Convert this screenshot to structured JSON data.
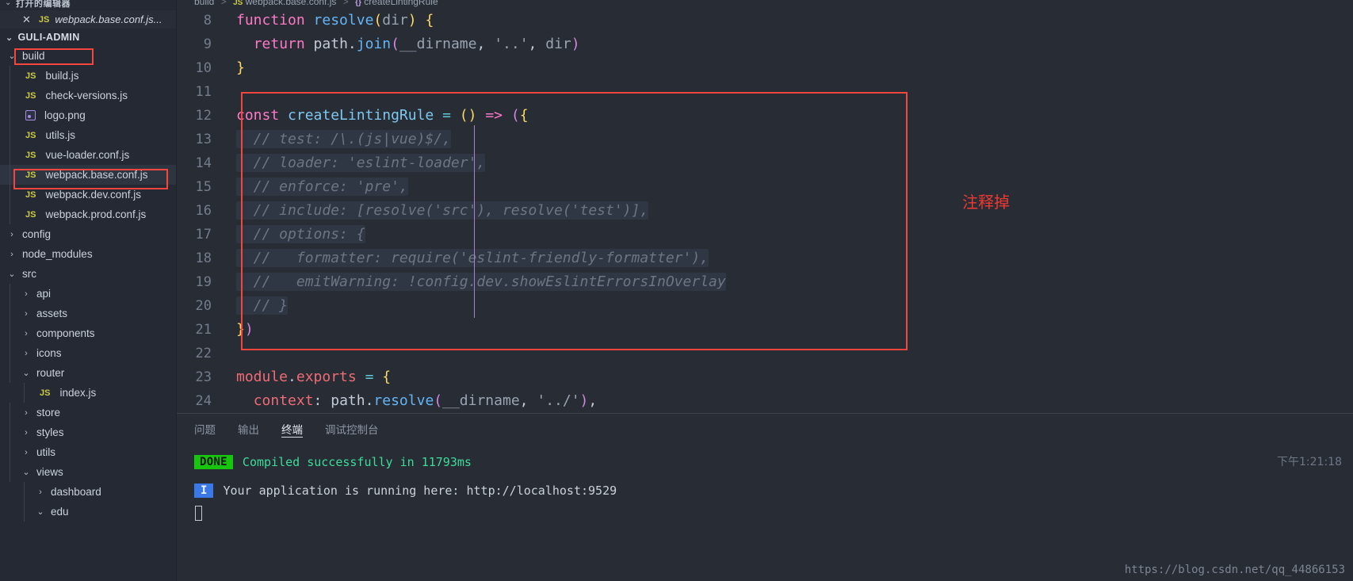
{
  "sidebar": {
    "open_editors_header": "打开的编辑器",
    "open_editor": {
      "close_icon": "close-icon",
      "file_badge": "JS",
      "name": "webpack.base.conf.js..."
    },
    "project_name": "GULI-ADMIN",
    "tree": [
      {
        "label": "build",
        "type": "folder",
        "state": "expanded",
        "depth": 0,
        "highlight": true
      },
      {
        "label": "build.js",
        "type": "js",
        "depth": 1
      },
      {
        "label": "check-versions.js",
        "type": "js",
        "depth": 1
      },
      {
        "label": "logo.png",
        "type": "png",
        "depth": 1
      },
      {
        "label": "utils.js",
        "type": "js",
        "depth": 1
      },
      {
        "label": "vue-loader.conf.js",
        "type": "js",
        "depth": 1
      },
      {
        "label": "webpack.base.conf.js",
        "type": "js",
        "depth": 1,
        "selected": true,
        "highlight": true
      },
      {
        "label": "webpack.dev.conf.js",
        "type": "js",
        "depth": 1
      },
      {
        "label": "webpack.prod.conf.js",
        "type": "js",
        "depth": 1
      },
      {
        "label": "config",
        "type": "folder",
        "state": "collapsed",
        "depth": 0
      },
      {
        "label": "node_modules",
        "type": "folder",
        "state": "collapsed",
        "depth": 0
      },
      {
        "label": "src",
        "type": "folder",
        "state": "expanded",
        "depth": 0
      },
      {
        "label": "api",
        "type": "folder",
        "state": "collapsed",
        "depth": 1
      },
      {
        "label": "assets",
        "type": "folder",
        "state": "collapsed",
        "depth": 1
      },
      {
        "label": "components",
        "type": "folder",
        "state": "collapsed",
        "depth": 1
      },
      {
        "label": "icons",
        "type": "folder",
        "state": "collapsed",
        "depth": 1
      },
      {
        "label": "router",
        "type": "folder",
        "state": "expanded",
        "depth": 1
      },
      {
        "label": "index.js",
        "type": "js",
        "depth": 2
      },
      {
        "label": "store",
        "type": "folder",
        "state": "collapsed",
        "depth": 1
      },
      {
        "label": "styles",
        "type": "folder",
        "state": "collapsed",
        "depth": 1
      },
      {
        "label": "utils",
        "type": "folder",
        "state": "collapsed",
        "depth": 1
      },
      {
        "label": "views",
        "type": "folder",
        "state": "expanded",
        "depth": 1
      },
      {
        "label": "dashboard",
        "type": "folder",
        "state": "collapsed",
        "depth": 2
      },
      {
        "label": "edu",
        "type": "folder",
        "state": "expanded",
        "depth": 2
      }
    ]
  },
  "breadcrumb": {
    "folder": "build",
    "file_badge": "JS",
    "file": "webpack.base.conf.js",
    "symbol_badge": "{}",
    "symbol": "createLintingRule",
    "separator": ">"
  },
  "code": {
    "lines": [
      {
        "n": "8",
        "segments": [
          {
            "t": "function",
            "c": "kw"
          },
          {
            "t": " ",
            "c": "plain"
          },
          {
            "t": "resolve",
            "c": "fnc"
          },
          {
            "t": "(",
            "c": "par"
          },
          {
            "t": "dir",
            "c": "var"
          },
          {
            "t": ")",
            "c": "par"
          },
          {
            "t": " ",
            "c": "plain"
          },
          {
            "t": "{",
            "c": "par"
          }
        ]
      },
      {
        "n": "9",
        "segments": [
          {
            "t": "  ",
            "c": "plain"
          },
          {
            "t": "return",
            "c": "kw"
          },
          {
            "t": " path",
            "c": "plain"
          },
          {
            "t": ".",
            "c": "plain"
          },
          {
            "t": "join",
            "c": "fnc"
          },
          {
            "t": "(",
            "c": "brkt-p"
          },
          {
            "t": "__dirname",
            "c": "var"
          },
          {
            "t": ", ",
            "c": "plain"
          },
          {
            "t": "'..'",
            "c": "str"
          },
          {
            "t": ", ",
            "c": "plain"
          },
          {
            "t": "dir",
            "c": "var"
          },
          {
            "t": ")",
            "c": "brkt-p"
          }
        ]
      },
      {
        "n": "10",
        "segments": [
          {
            "t": "}",
            "c": "par"
          }
        ]
      },
      {
        "n": "11",
        "segments": []
      },
      {
        "n": "12",
        "segments": [
          {
            "t": "const",
            "c": "kw"
          },
          {
            "t": " ",
            "c": "plain"
          },
          {
            "t": "createLintingRule",
            "c": "ident"
          },
          {
            "t": " ",
            "c": "plain"
          },
          {
            "t": "=",
            "c": "op"
          },
          {
            "t": " ",
            "c": "plain"
          },
          {
            "t": "(",
            "c": "par"
          },
          {
            "t": ")",
            "c": "par"
          },
          {
            "t": " ",
            "c": "plain"
          },
          {
            "t": "=>",
            "c": "kw"
          },
          {
            "t": " ",
            "c": "plain"
          },
          {
            "t": "(",
            "c": "brkt-p"
          },
          {
            "t": "{",
            "c": "par"
          }
        ]
      },
      {
        "n": "13",
        "comment": "  // test: /\\.(js|vue)$/,"
      },
      {
        "n": "14",
        "comment": "  // loader: 'eslint-loader',"
      },
      {
        "n": "15",
        "comment": "  // enforce: 'pre',"
      },
      {
        "n": "16",
        "comment": "  // include: [resolve('src'), resolve('test')],"
      },
      {
        "n": "17",
        "comment": "  // options: {"
      },
      {
        "n": "18",
        "comment": "  //   formatter: require('eslint-friendly-formatter'),"
      },
      {
        "n": "19",
        "comment": "  //   emitWarning: !config.dev.showEslintErrorsInOverlay"
      },
      {
        "n": "20",
        "comment": "  // }"
      },
      {
        "n": "21",
        "segments": [
          {
            "t": "}",
            "c": "par"
          },
          {
            "t": ")",
            "c": "brkt-p"
          }
        ]
      },
      {
        "n": "22",
        "segments": []
      },
      {
        "n": "23",
        "segments": [
          {
            "t": "module",
            "c": "mexp"
          },
          {
            "t": ".",
            "c": "plain"
          },
          {
            "t": "exports",
            "c": "mexp"
          },
          {
            "t": " ",
            "c": "plain"
          },
          {
            "t": "=",
            "c": "op"
          },
          {
            "t": " ",
            "c": "plain"
          },
          {
            "t": "{",
            "c": "par"
          }
        ]
      },
      {
        "n": "24",
        "segments": [
          {
            "t": "  ",
            "c": "plain"
          },
          {
            "t": "context",
            "c": "mexp"
          },
          {
            "t": ":",
            "c": "plain"
          },
          {
            "t": " path",
            "c": "plain"
          },
          {
            "t": ".",
            "c": "plain"
          },
          {
            "t": "resolve",
            "c": "fnc"
          },
          {
            "t": "(",
            "c": "brkt-p"
          },
          {
            "t": "__dirname",
            "c": "var"
          },
          {
            "t": ", ",
            "c": "plain"
          },
          {
            "t": "'../'",
            "c": "str"
          },
          {
            "t": ")",
            "c": "brkt-p"
          },
          {
            "t": ",",
            "c": "plain"
          }
        ]
      }
    ]
  },
  "annotation": {
    "note_cn": "注释掉",
    "note_color": "#ee3a33"
  },
  "panel": {
    "tabs": [
      {
        "label": "问题",
        "active": false
      },
      {
        "label": "输出",
        "active": false
      },
      {
        "label": "终端",
        "active": true
      },
      {
        "label": "调试控制台",
        "active": false
      }
    ],
    "terminal": {
      "done_badge": "DONE",
      "done_message": "Compiled successfully in 11793ms",
      "info_badge": "I",
      "info_message": "Your application is running here: http://localhost:9529"
    },
    "timestamp": "下午1:21:18"
  },
  "watermark": "https://blog.csdn.net/qq_44866153",
  "colors": {
    "accent_red": "#f4463c",
    "done_green": "#16c60c",
    "terminal_green": "#3ddc9a",
    "info_blue": "#3b78e7",
    "sidebar_bg": "#242933",
    "editor_bg": "#272c35"
  }
}
